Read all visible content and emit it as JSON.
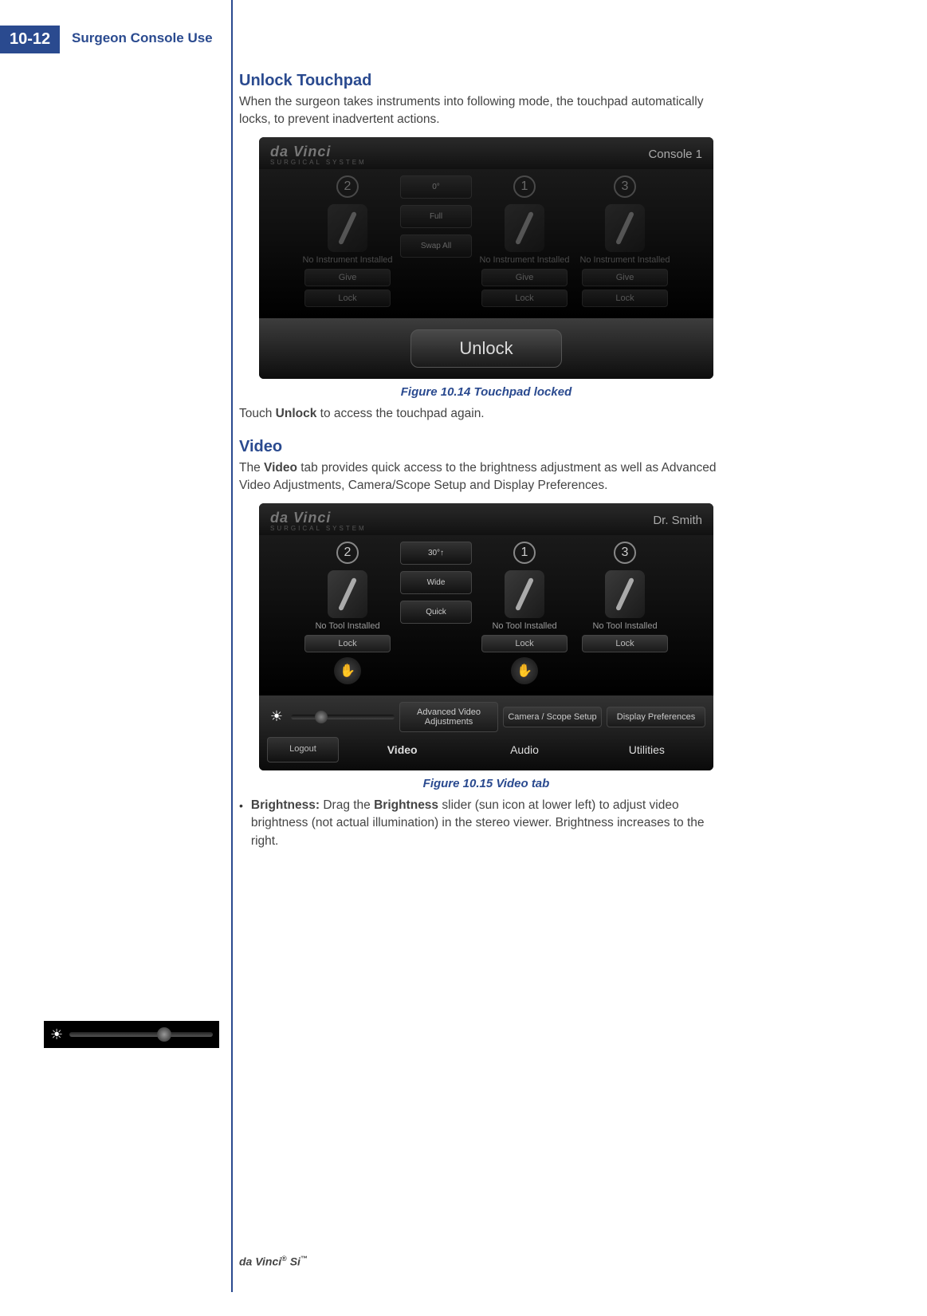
{
  "page": {
    "number": "10-12",
    "chapter": "Surgeon Console Use",
    "footer_brand": "da Vinci",
    "footer_model": "Si",
    "footer_reg": "®",
    "footer_tm": "™"
  },
  "sections": {
    "unlock": {
      "heading": "Unlock Touchpad",
      "intro": "When the surgeon takes instruments into following mode, the touchpad automatically locks, to prevent inadvertent actions.",
      "caption": "Figure 10.14 Touchpad locked",
      "after": "Touch Unlock to access the touchpad again.",
      "after_prefix": "Touch ",
      "after_bold": "Unlock",
      "after_suffix": " to access the touchpad again."
    },
    "video": {
      "heading": "Video",
      "intro_prefix": "The ",
      "intro_bold": "Video",
      "intro_suffix": " tab provides quick access to the brightness adjustment as well as Advanced Video Adjustments, Camera/Scope Setup and Display Preferences.",
      "caption": "Figure 10.15 Video tab",
      "bullet_label": "Brightness:",
      "bullet_text_1": " Drag the ",
      "bullet_bold_2": "Brightness",
      "bullet_text_2": " slider (sun icon at lower left) to adjust video brightness (not actual illumination) in the stereo viewer. Brightness increases to the right."
    }
  },
  "screenshot1": {
    "logo": "da Vinci",
    "logo_sub": "SURGICAL SYSTEM",
    "console": "Console 1",
    "arms": [
      {
        "num": "2",
        "status": "No Instrument Installed",
        "give": "Give",
        "lock": "Lock"
      },
      {
        "num": "1",
        "status": "No Instrument Installed",
        "give": "Give",
        "lock": "Lock"
      },
      {
        "num": "3",
        "status": "No Instrument Installed",
        "give": "Give",
        "lock": "Lock"
      }
    ],
    "center": {
      "angle": "0°",
      "full": "Full",
      "swap": "Swap All"
    },
    "unlock": "Unlock"
  },
  "screenshot2": {
    "logo": "da Vinci",
    "logo_sub": "SURGICAL SYSTEM",
    "user": "Dr. Smith",
    "arms": [
      {
        "num": "2",
        "status": "No Tool Installed",
        "lock": "Lock"
      },
      {
        "num": "1",
        "status": "No Tool Installed",
        "lock": "Lock"
      },
      {
        "num": "3",
        "status": "No Tool Installed",
        "lock": "Lock"
      }
    ],
    "center": {
      "angle": "30°↑",
      "wide": "Wide",
      "quick": "Quick"
    },
    "bottom_options": [
      "Advanced Video Adjustments",
      "Camera / Scope Setup",
      "Display Preferences"
    ],
    "logout": "Logout",
    "tabs": [
      "Video",
      "Audio",
      "Utilities"
    ]
  }
}
